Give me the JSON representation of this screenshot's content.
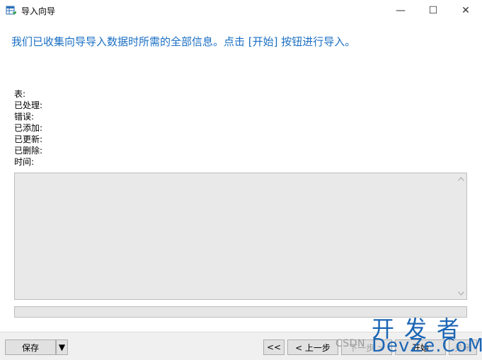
{
  "window": {
    "title": "导入向导",
    "minimize_glyph": "—",
    "maximize_glyph": "☐",
    "close_glyph": "✕"
  },
  "heading": "我们已收集向导导入数据时所需的全部信息。点击 [开始] 按钮进行导入。",
  "stats": {
    "table": "表:",
    "processed": "已处理:",
    "errors": "错误:",
    "added": "已添加:",
    "updated": "已更新:",
    "deleted": "已删除:",
    "time": "时间:"
  },
  "progress": {
    "value": 0
  },
  "footer": {
    "save_label": "保存",
    "save_dropdown_glyph": "▼",
    "first_label": "<<",
    "prev_label": "< 上一步",
    "next_label": "下一步 >",
    "start_label": "开始",
    "close_label": "关闭"
  },
  "watermark": {
    "text": "CSDN",
    "logo_line1": "开发者",
    "logo_line2": "DevZe.CoM"
  },
  "icons": {
    "app": "table-import-icon",
    "scroll_up": "chevron-up-icon",
    "scroll_down": "chevron-down-icon"
  },
  "colors": {
    "heading": "#1a6fc4",
    "watermark_logo": "#1c66b5"
  }
}
